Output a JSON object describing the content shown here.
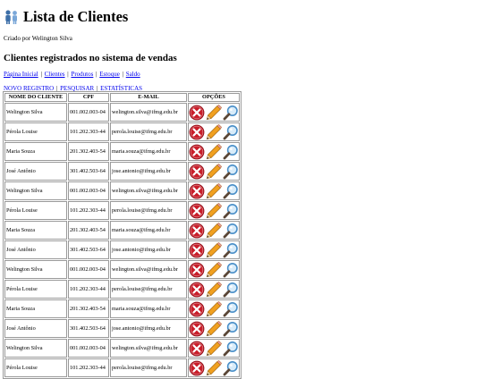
{
  "page": {
    "title": "Lista de Clientes",
    "author": "Criado por Welington Silva",
    "subtitle": "Clientes registrados no sistema de vendas"
  },
  "nav": {
    "links": [
      "Página Inicial",
      "Clientes",
      "Produtos",
      "Estoque",
      "Saldo"
    ],
    "separator": "|"
  },
  "actions": {
    "new": "NOVO REGISTRO",
    "search": "PESQUISAR",
    "stats": "ESTATÍSTICAS"
  },
  "table": {
    "headers": [
      "NOME DO CLIENTE",
      "CPF",
      "E-MAIL",
      "OPÇÕES"
    ],
    "rows": [
      {
        "name": "Welington Silva",
        "cpf": "001.002.003-04",
        "email": "welington.silva@ifmg.edu.br"
      },
      {
        "name": "Pérola Louise",
        "cpf": "101.202.303-44",
        "email": "perola.louise@ifmg.edu.br"
      },
      {
        "name": "Maria Souza",
        "cpf": "201.302.403-54",
        "email": "maria.souza@ifmg.edu.br"
      },
      {
        "name": "José Antônio",
        "cpf": "301.402.503-64",
        "email": "jose.antonio@ifmg.edu.br"
      },
      {
        "name": "Welington Silva",
        "cpf": "001.002.003-04",
        "email": "welington.silva@ifmg.edu.br"
      },
      {
        "name": "Pérola Louise",
        "cpf": "101.202.303-44",
        "email": "perola.louise@ifmg.edu.br"
      },
      {
        "name": "Maria Souza",
        "cpf": "201.302.403-54",
        "email": "maria.souza@ifmg.edu.br"
      },
      {
        "name": "José Antônio",
        "cpf": "301.402.503-64",
        "email": "jose.antonio@ifmg.edu.br"
      },
      {
        "name": "Welington Silva",
        "cpf": "001.002.003-04",
        "email": "welington.silva@ifmg.edu.br"
      },
      {
        "name": "Pérola Louise",
        "cpf": "101.202.303-44",
        "email": "perola.louise@ifmg.edu.br"
      },
      {
        "name": "Maria Souza",
        "cpf": "201.302.403-54",
        "email": "maria.souza@ifmg.edu.br"
      },
      {
        "name": "José Antônio",
        "cpf": "301.402.503-64",
        "email": "jose.antonio@ifmg.edu.br"
      },
      {
        "name": "Welington Silva",
        "cpf": "001.002.003-04",
        "email": "welington.silva@ifmg.edu.br"
      },
      {
        "name": "Pérola Louise",
        "cpf": "101.202.303-44",
        "email": "perola.louise@ifmg.edu.br"
      }
    ],
    "row_icons": [
      "delete-icon",
      "edit-pencil-icon",
      "view-magnifier-icon"
    ]
  },
  "colors": {
    "link": "#0000ee",
    "delete_red": "#c81e2a",
    "pencil_orange": "#f0a020",
    "magnifier_blue": "#4a8fc8",
    "border": "#9a9a9a"
  },
  "icons": {
    "title": "people-icon"
  }
}
